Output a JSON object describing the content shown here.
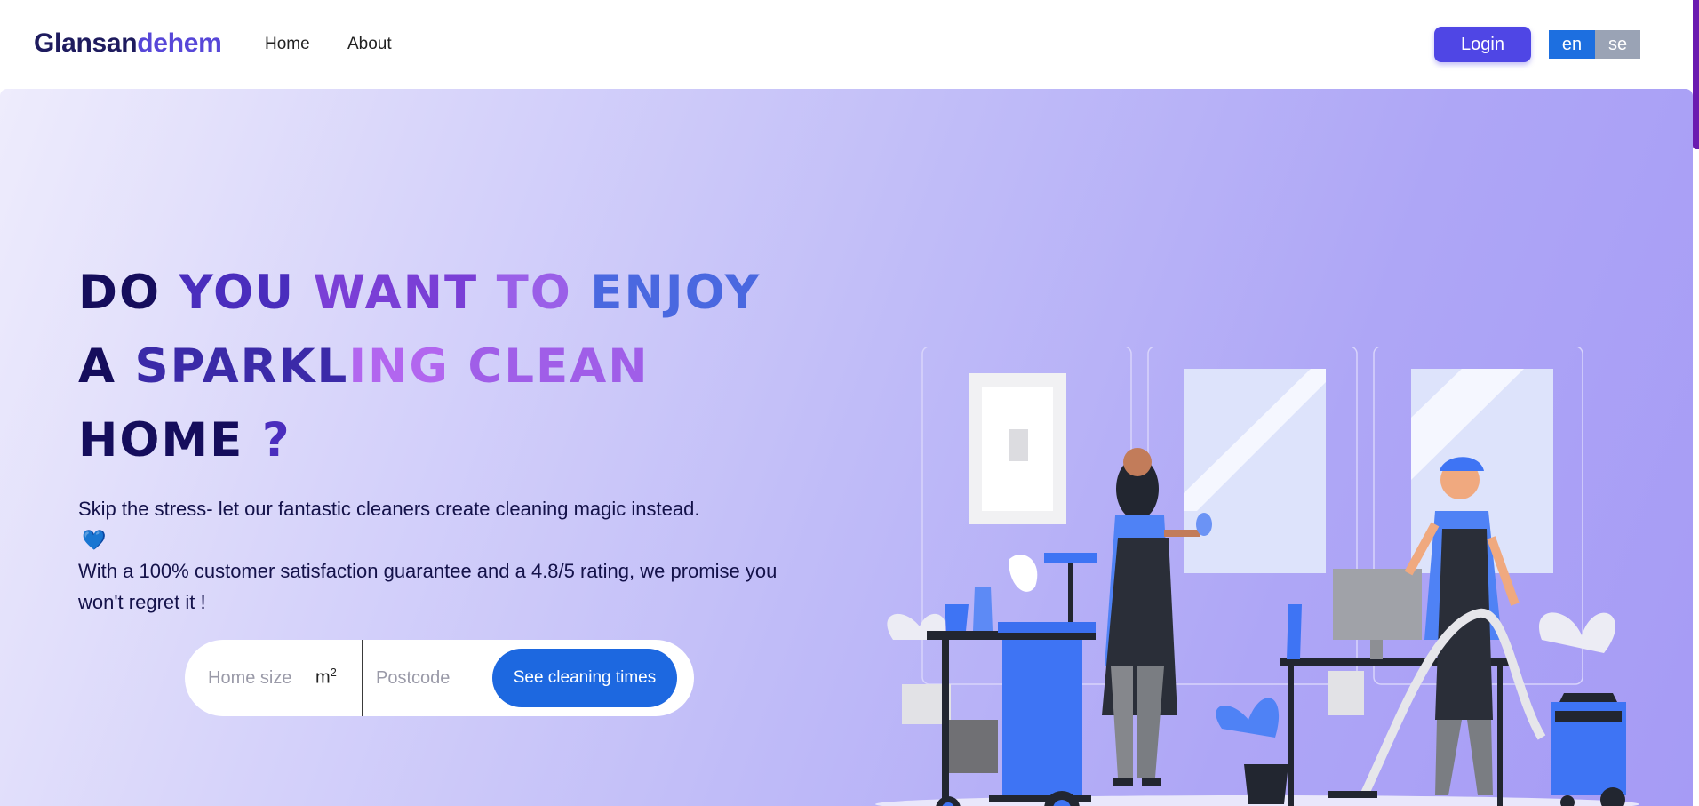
{
  "brand": {
    "part1": "Glansan",
    "part2": "dehem"
  },
  "nav": {
    "home": "Home",
    "about": "About"
  },
  "header": {
    "login": "Login",
    "lang_en": "en",
    "lang_se": "se"
  },
  "hero": {
    "headline": {
      "l1_w1": "DO ",
      "l1_w2": "YOU ",
      "l1_w3": "WANT ",
      "l1_w4": "TO ",
      "l1_w5": "ENJOY",
      "l2_w1": "A ",
      "l2_w2": "SPARKL",
      "l2_w3": "ING ",
      "l2_w4": "CLEAN",
      "l3_w1": "HOME ",
      "l3_w2": "?"
    },
    "text1": "Skip the stress- let our fantastic cleaners create cleaning magic instead.",
    "heart": "💙",
    "text2": "With a 100% customer satisfaction guarantee and a 4.8/5 rating, we promise you won't regret it !"
  },
  "search": {
    "home_size_placeholder": "Home size",
    "unit": "m",
    "unit_sup": "2",
    "postcode_placeholder": "Postcode",
    "button": "See cleaning times"
  },
  "colors": {
    "accent": "#4f46e5",
    "button_blue": "#1d68e0",
    "brand_navy": "#1e1b5e"
  },
  "illustration": {
    "icon": "cleaners-illustration"
  }
}
